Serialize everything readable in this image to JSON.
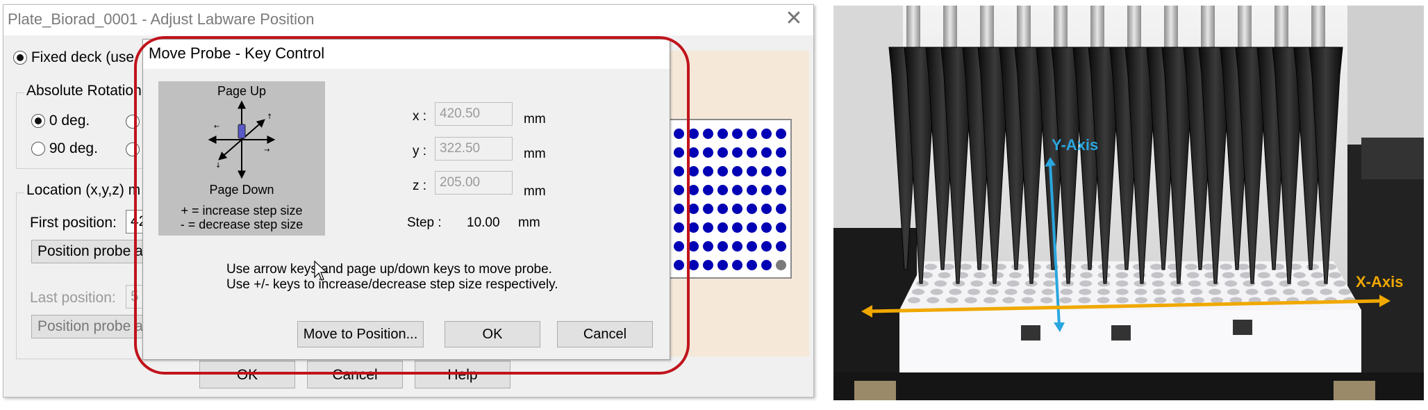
{
  "window": {
    "title": "Plate_Biorad_0001 - Adjust Labware Position",
    "fixed_deck_label": "Fixed deck (use",
    "absolute_rotation_label": "Absolute Rotation:",
    "rotation_options": [
      "0 deg.",
      "90 deg."
    ],
    "location_label": "Location (x,y,z) m",
    "first_position_label": "First position:",
    "first_position_value": "42",
    "position_probe_label_1": "Position probe a",
    "last_position_label": "Last position:",
    "last_position_value": "5",
    "position_probe_label_2": "Position probe a",
    "ok_label": "OK",
    "cancel_label": "Cancel",
    "help_label": "Help"
  },
  "dialog": {
    "title": "Move Probe - Key Control",
    "page_up": "Page Up",
    "page_down": "Page Down",
    "hint_plus": "+ = increase step size",
    "hint_minus": "- = decrease step size",
    "x_label": "x :",
    "x_value": "420.50",
    "y_label": "y :",
    "y_value": "322.50",
    "z_label": "z :",
    "z_value": "205.00",
    "unit": "mm",
    "step_label": "Step :",
    "step_value": "10.00",
    "step_unit": "mm",
    "instruction_1": "Use arrow keys and page up/down keys to move probe.",
    "instruction_2": "Use +/- keys to increase/decrease step size respectively.",
    "move_button": "Move to Position...",
    "ok_button": "OK",
    "cancel_button": "Cancel"
  },
  "photo": {
    "y_axis_label": "Y-Axis",
    "x_axis_label": "X-Axis",
    "y_axis_color": "#2aa6df",
    "x_axis_color": "#f0a800"
  },
  "colors": {
    "highlight": "#c0141c",
    "well": "#0000b4"
  }
}
